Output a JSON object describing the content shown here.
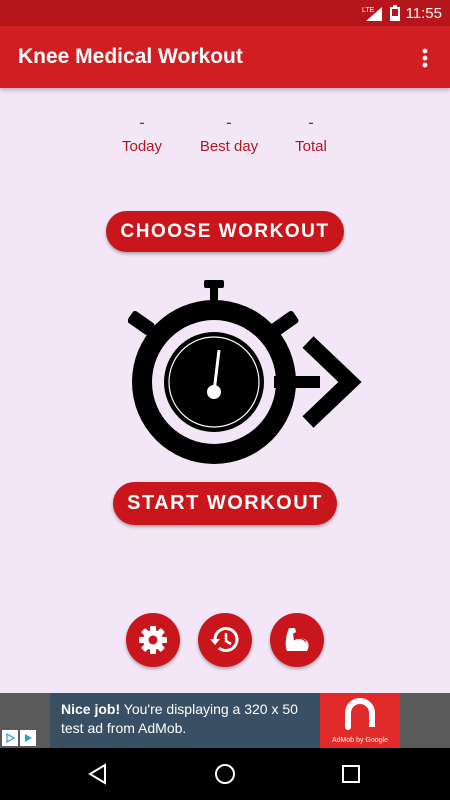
{
  "status_bar": {
    "network": "LTE",
    "time": "11:55"
  },
  "app_bar": {
    "title": "Knee Medical Workout",
    "menu_icon": "more-vert-icon"
  },
  "stats": [
    {
      "value": "-",
      "label": "Today"
    },
    {
      "value": "-",
      "label": "Best day"
    },
    {
      "value": "-",
      "label": "Total"
    }
  ],
  "buttons": {
    "choose_workout": "CHOOSE WORKOUT",
    "start_workout": "START WORKOUT"
  },
  "bottom_actions": [
    {
      "name": "settings",
      "icon": "gear-icon"
    },
    {
      "name": "history",
      "icon": "history-icon"
    },
    {
      "name": "muscle",
      "icon": "muscle-arm-icon"
    }
  ],
  "ad": {
    "headline": "Nice job!",
    "text": "You're displaying a 320 x 50 test ad from AdMob.",
    "brand": "AdMob by Google"
  },
  "nav": {
    "back": "back-icon",
    "home": "home-icon",
    "recents": "recents-icon"
  },
  "colors": {
    "primary": "#d11e22",
    "primary_dark": "#b5161c",
    "background": "#f2e6f7"
  }
}
